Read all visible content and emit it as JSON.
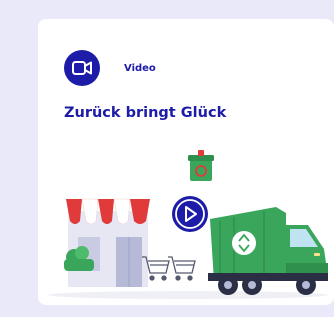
{
  "card": {
    "type_label": "Video",
    "title": "Zurück bringt Glück",
    "type_icon": "video-camera-icon",
    "play_icon": "play-icon",
    "illustration_icon": "recycling-truck-store-illustration"
  },
  "colors": {
    "background": "#e9e9fa",
    "accent": "#1c1ca8",
    "truck_green": "#3aa65c",
    "awning_red": "#e03a3a"
  }
}
